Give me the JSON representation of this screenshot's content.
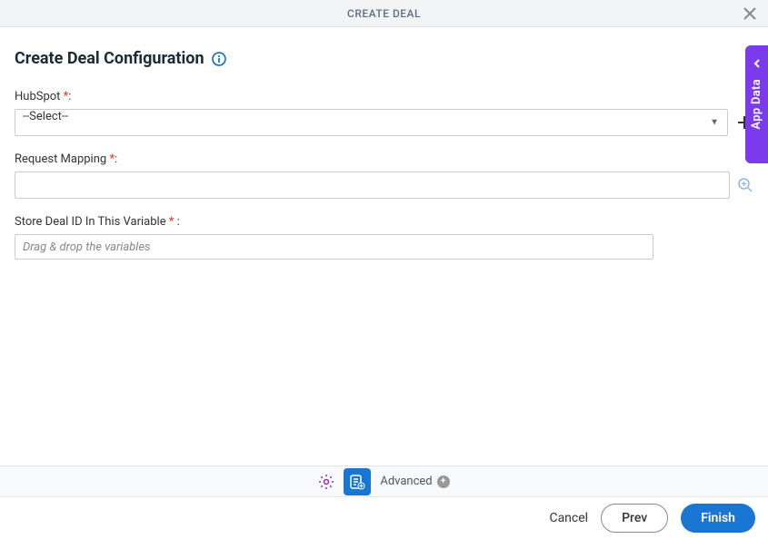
{
  "header": {
    "title": "CREATE DEAL"
  },
  "page": {
    "title": "Create Deal Configuration"
  },
  "fields": {
    "hubspot": {
      "label": "HubSpot ",
      "select_value": "--Select--"
    },
    "request_mapping": {
      "label": "Request Mapping "
    },
    "store_deal_id": {
      "label": "Store Deal ID In This Variable ",
      "placeholder": "Drag & drop the variables"
    }
  },
  "side_tab": {
    "label": "App Data"
  },
  "toolbar": {
    "advanced_label": "Advanced"
  },
  "footer": {
    "cancel": "Cancel",
    "prev": "Prev",
    "finish": "Finish"
  }
}
